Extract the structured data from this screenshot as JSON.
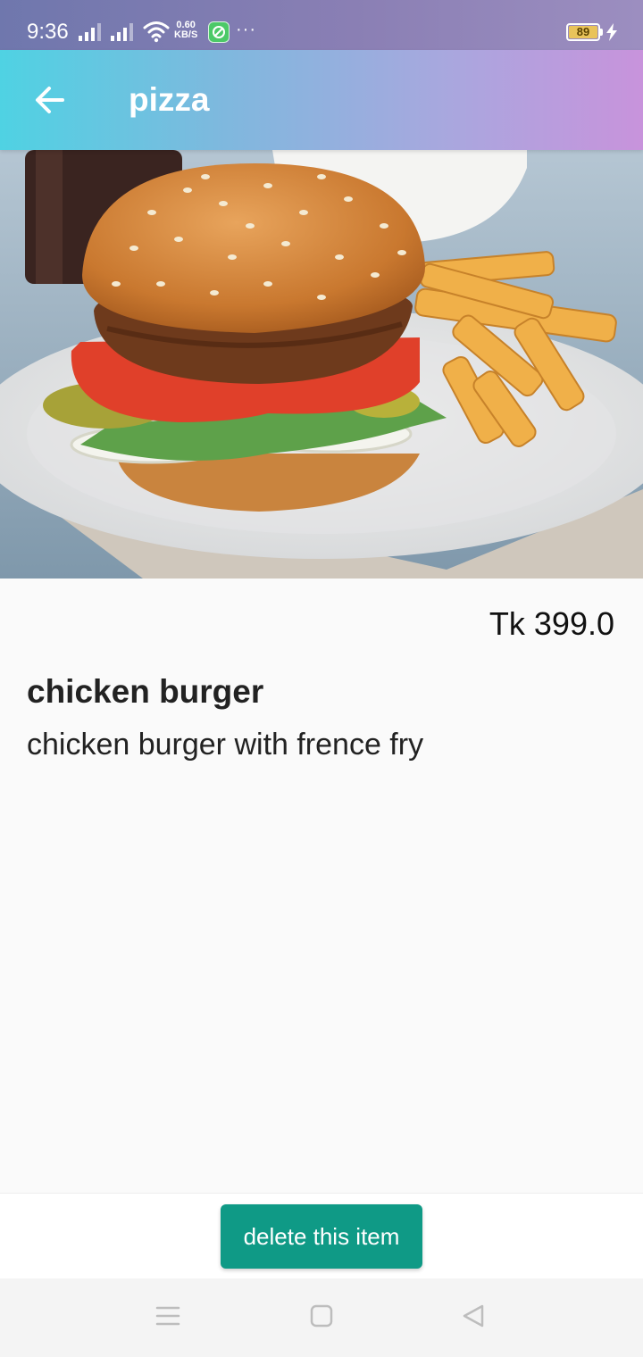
{
  "status_bar": {
    "time": "9:36",
    "net_speed_value": "0.60",
    "net_speed_unit": "KB/S",
    "overflow": "···",
    "battery_level": "89",
    "icons": [
      "signal-icon",
      "signal-icon",
      "wifi-icon",
      "app-notification-icon",
      "battery-icon",
      "charging-icon"
    ]
  },
  "app_bar": {
    "title": "pizza",
    "back_icon": "arrow-back-icon"
  },
  "item": {
    "price": "Tk 399.0",
    "name": "chicken burger",
    "description": "chicken burger with frence fry"
  },
  "actions": {
    "delete_label": "delete this item"
  },
  "nav_bar": {
    "icons": [
      "menu-icon",
      "home-icon",
      "back-icon"
    ]
  },
  "colors": {
    "accent_button": "#0f9a86",
    "appbar_gradient_start": "#4fd2e3",
    "appbar_gradient_end": "#c893dc"
  }
}
